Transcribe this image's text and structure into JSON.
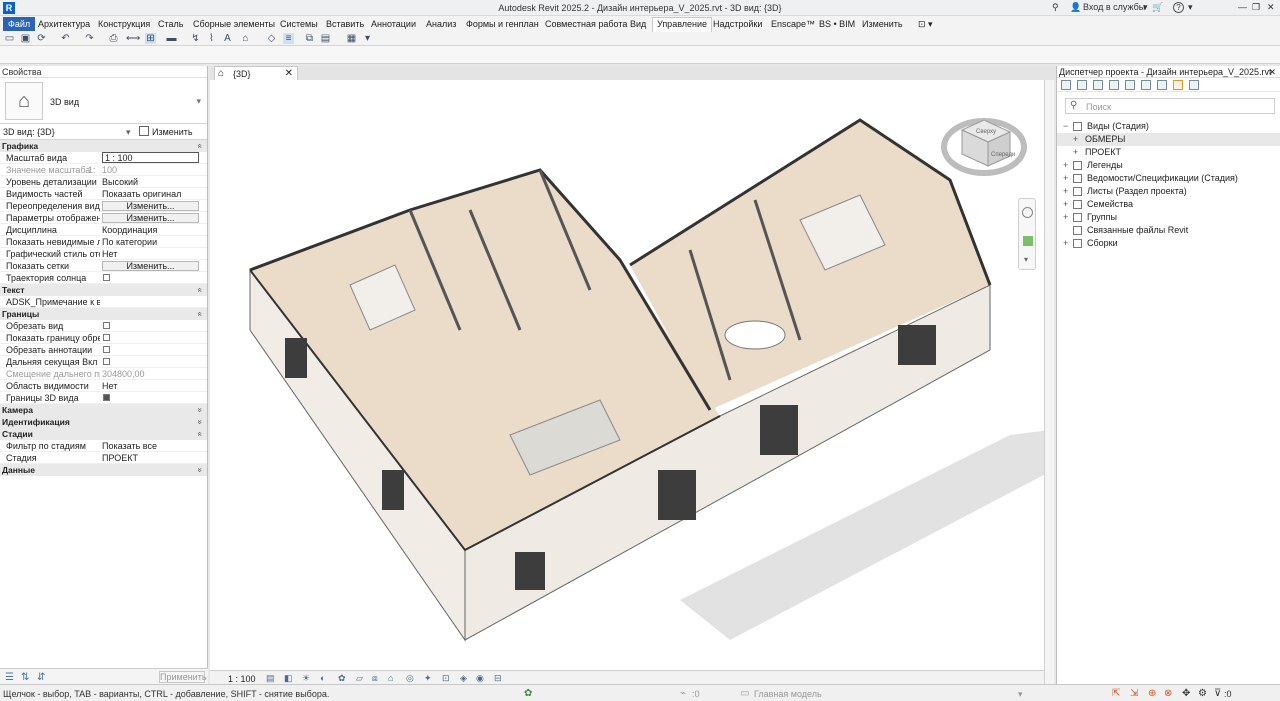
{
  "window": {
    "title": "Autodesk Revit 2025.2 - Дизайн интерьера_V_2025.rvt - 3D вид: {3D}",
    "app_letter": "R",
    "signin": "Вход в службы",
    "help": "?"
  },
  "menu": [
    "Файл",
    "Архитектура",
    "Конструкция",
    "Сталь",
    "Сборные элементы",
    "Системы",
    "Вставить",
    "Аннотации",
    "Анализ",
    "Формы и генплан",
    "Совместная работа",
    "Вид",
    "Управление",
    "Надстройки",
    "Enscape™",
    "BS • BIM",
    "Изменить"
  ],
  "menu_active": "Управление",
  "properties": {
    "title": "Свойства",
    "type_name": "3D вид",
    "instance_selector": "3D вид: {3D}",
    "edit_type": "Изменить тип",
    "sections": [
      {
        "name": "Графика",
        "collapsed": false,
        "rows": [
          {
            "k": "Масштаб вида",
            "v": "1 : 100",
            "kind": "input"
          },
          {
            "k": "Значение масштаба",
            "k2": "1:",
            "v": "100",
            "kind": "disabled"
          },
          {
            "k": "Уровень детализации",
            "v": "Высокий",
            "kind": "text"
          },
          {
            "k": "Видимость частей",
            "v": "Показать оригинал",
            "kind": "text"
          },
          {
            "k": "Переопределения види...",
            "v": "Изменить...",
            "kind": "button"
          },
          {
            "k": "Параметры отображен...",
            "v": "Изменить...",
            "kind": "button"
          },
          {
            "k": "Дисциплина",
            "v": "Координация",
            "kind": "text"
          },
          {
            "k": "Показать невидимые л...",
            "v": "По категории",
            "kind": "text"
          },
          {
            "k": "Графический стиль ото...",
            "v": "Нет",
            "kind": "text"
          },
          {
            "k": "Показать сетки",
            "v": "Изменить...",
            "kind": "button"
          },
          {
            "k": "Траектория солнца",
            "v": "",
            "kind": "checkbox",
            "checked": false
          }
        ]
      },
      {
        "name": "Текст",
        "collapsed": false,
        "rows": [
          {
            "k": "ADSK_Примечание к ви...",
            "v": "",
            "kind": "text"
          }
        ]
      },
      {
        "name": "Границы",
        "collapsed": false,
        "rows": [
          {
            "k": "Обрезать вид",
            "v": "",
            "kind": "checkbox",
            "checked": false
          },
          {
            "k": "Показать границу обре...",
            "v": "",
            "kind": "checkbox",
            "checked": false
          },
          {
            "k": "Обрезать аннотации",
            "v": "",
            "kind": "checkbox",
            "checked": false
          },
          {
            "k": "Дальняя секущая Вкл",
            "v": "",
            "kind": "checkbox",
            "checked": false
          },
          {
            "k": "Смещение дальнего пр...",
            "v": "304800,00",
            "kind": "disabled"
          },
          {
            "k": "Область видимости",
            "v": "Нет",
            "kind": "text"
          },
          {
            "k": "Границы 3D вида",
            "v": "",
            "kind": "checkbox",
            "checked": true
          }
        ]
      },
      {
        "name": "Камера",
        "collapsed": true,
        "rows": []
      },
      {
        "name": "Идентификация",
        "collapsed": true,
        "rows": []
      },
      {
        "name": "Стадии",
        "collapsed": false,
        "rows": [
          {
            "k": "Фильтр по стадиям",
            "v": "Показать все",
            "kind": "text"
          },
          {
            "k": "Стадия",
            "v": "ПРОЕКТ",
            "kind": "text"
          }
        ]
      },
      {
        "name": "Данные",
        "collapsed": true,
        "rows": []
      }
    ],
    "apply": "Применить"
  },
  "view": {
    "tab": "{3D}",
    "scale": "1 : 100",
    "viewcube_top": "Сверху",
    "viewcube_front": "Спереди"
  },
  "browser": {
    "title": "Диспетчер проекта - Дизайн интерьера_V_2025.rvt",
    "search_placeholder": "Поиск",
    "tree": [
      {
        "level": 0,
        "exp": "−",
        "label": "Виды (Стадия)",
        "icon": true
      },
      {
        "level": 1,
        "exp": "+",
        "label": "ОБМЕРЫ",
        "icon": false,
        "selected": true
      },
      {
        "level": 1,
        "exp": "+",
        "label": "ПРОЕКТ",
        "icon": false
      },
      {
        "level": 0,
        "exp": "+",
        "label": "Легенды",
        "icon": true
      },
      {
        "level": 0,
        "exp": "+",
        "label": "Ведомости/Спецификации (Стадия)",
        "icon": true
      },
      {
        "level": 0,
        "exp": "+",
        "label": "Листы (Раздел проекта)",
        "icon": true
      },
      {
        "level": 0,
        "exp": "+",
        "label": "Семейства",
        "icon": true
      },
      {
        "level": 0,
        "exp": "+",
        "label": "Группы",
        "icon": true
      },
      {
        "level": 0,
        "exp": "",
        "label": "Связанные файлы Revit",
        "icon": true
      },
      {
        "level": 0,
        "exp": "+",
        "label": "Сборки",
        "icon": true
      }
    ]
  },
  "status": {
    "hint": "Щелчок - выбор, TAB - варианты, CTRL - добавление, SHIFT - снятие выбора.",
    "workset_count": ":0",
    "model": "Главная модель",
    "filter_count": ":0"
  }
}
